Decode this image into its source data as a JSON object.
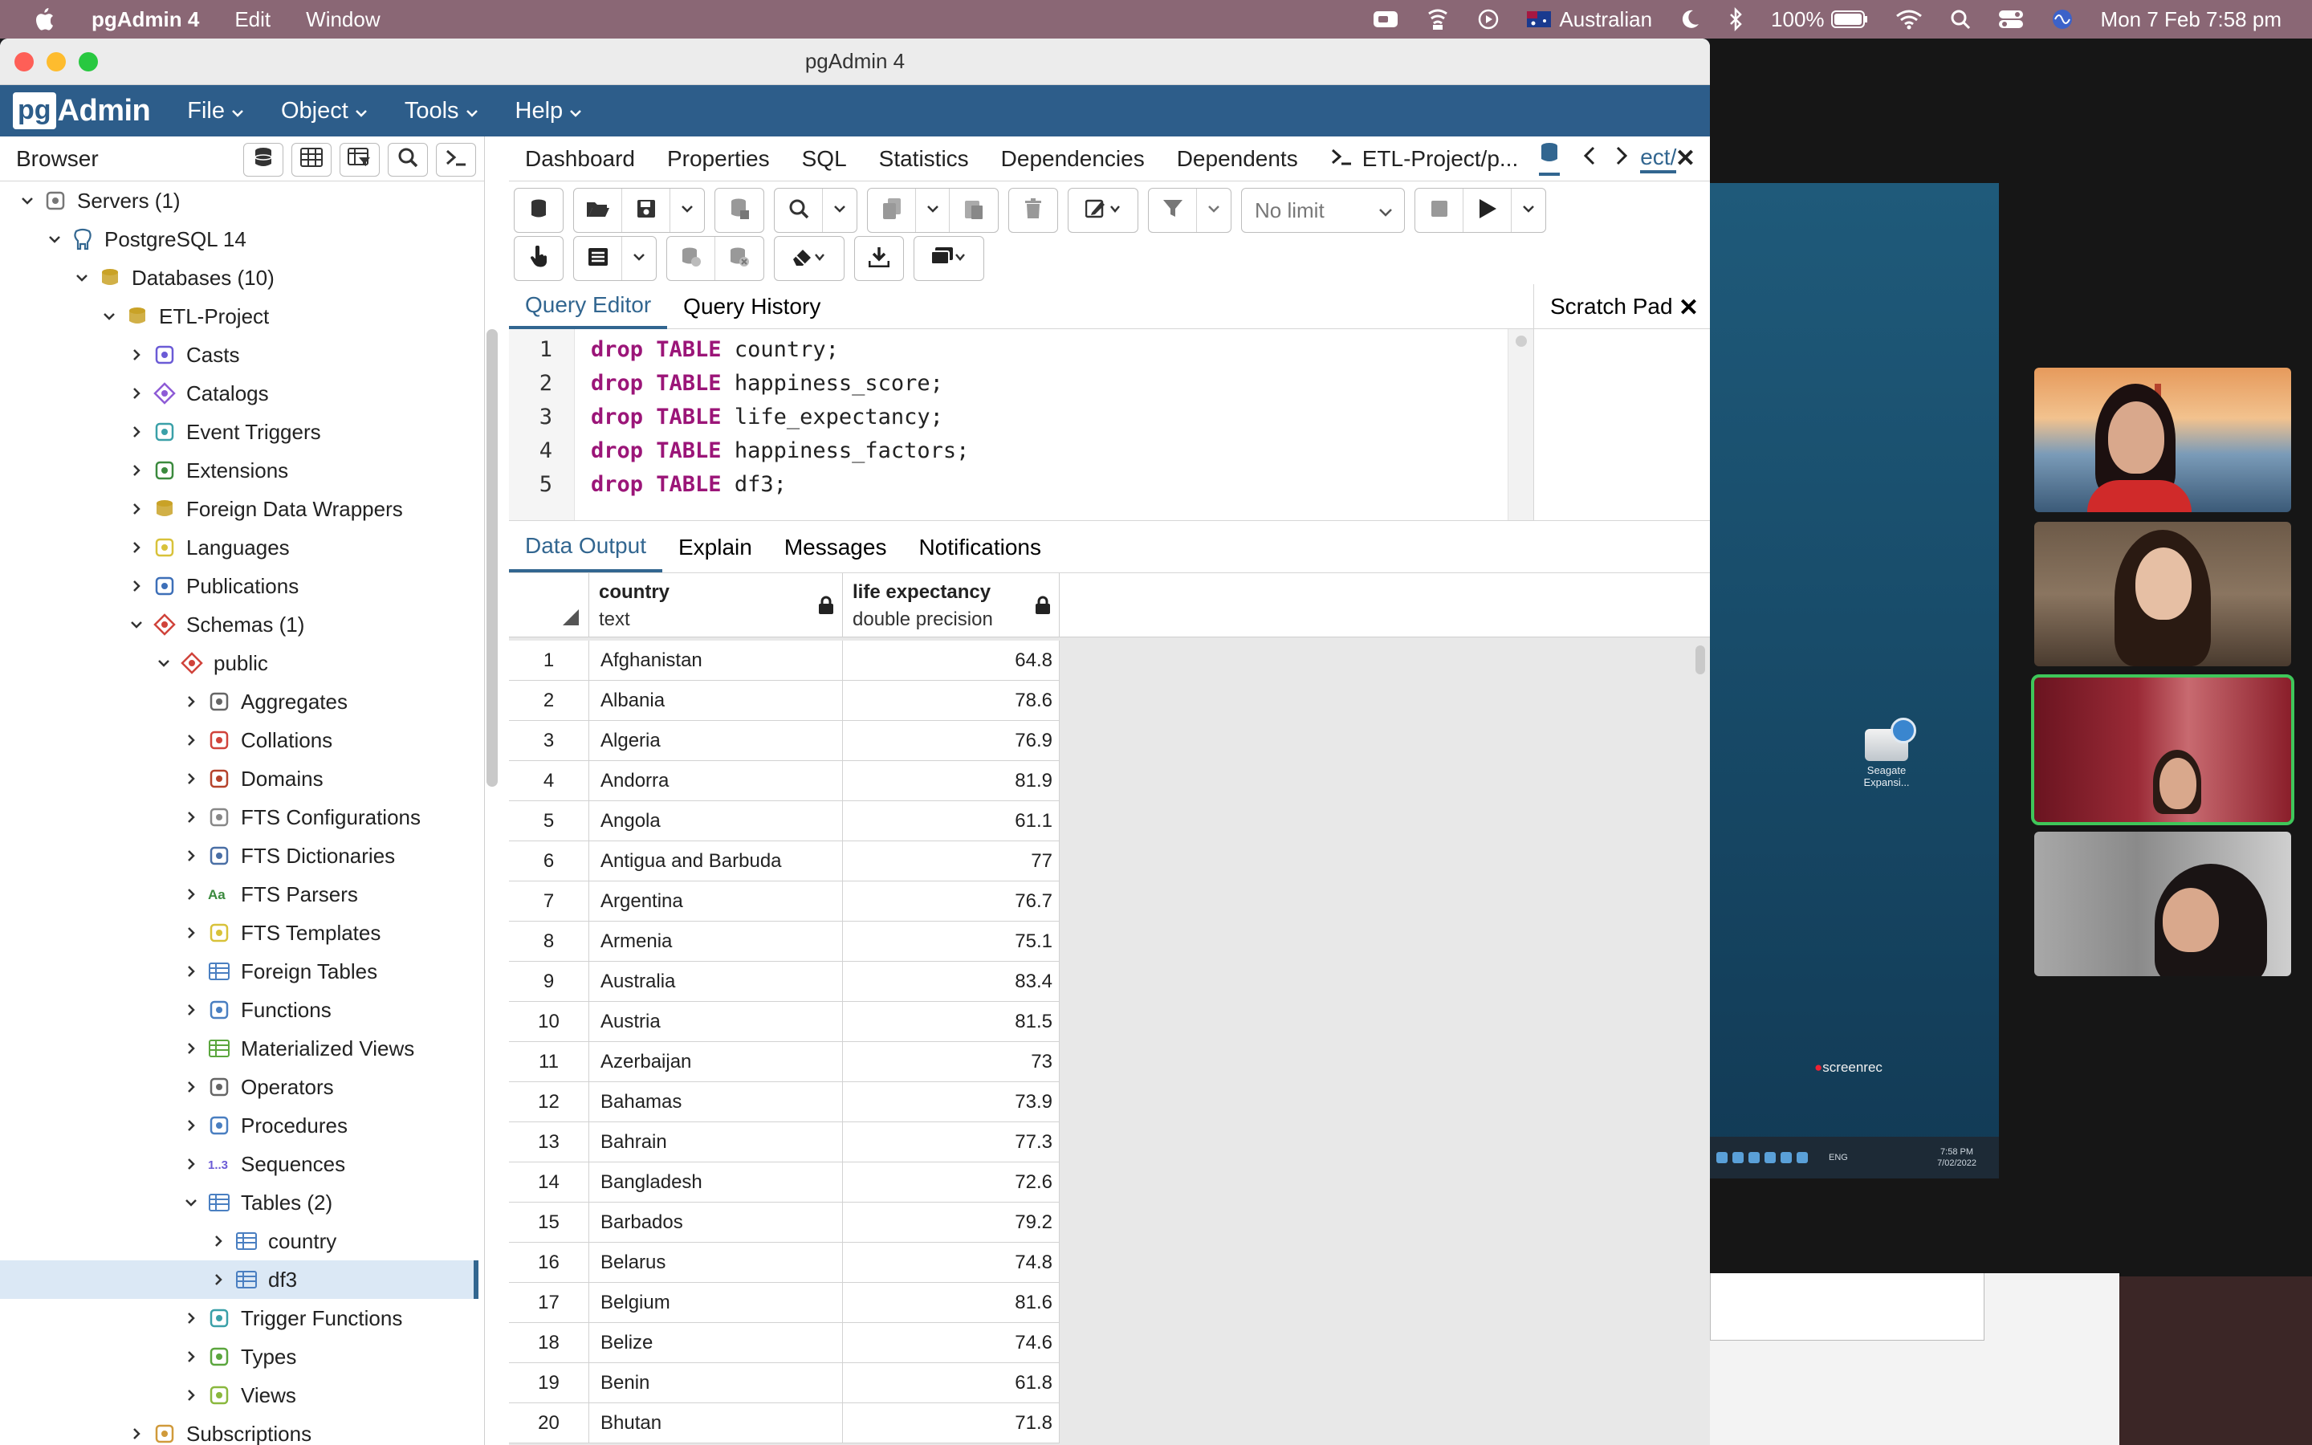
{
  "menubar": {
    "app_name": "pgAdmin 4",
    "items": [
      "Edit",
      "Window"
    ],
    "input_source": "Australian",
    "battery": "100%",
    "datetime": "Mon 7 Feb  7:58 pm"
  },
  "window": {
    "title": "pgAdmin 4"
  },
  "app_menu": {
    "logo_pg": "pg",
    "logo_admin": "Admin",
    "items": [
      "File",
      "Object",
      "Tools",
      "Help"
    ]
  },
  "browser": {
    "title": "Browser",
    "tree": [
      {
        "label": "Servers (1)",
        "depth": 0,
        "expanded": true,
        "icon": "servers-icon"
      },
      {
        "label": "PostgreSQL 14",
        "depth": 1,
        "expanded": true,
        "icon": "postgres-elephant-icon"
      },
      {
        "label": "Databases (10)",
        "depth": 2,
        "expanded": true,
        "icon": "databases-icon"
      },
      {
        "label": "ETL-Project",
        "depth": 3,
        "expanded": true,
        "icon": "database-icon"
      },
      {
        "label": "Casts",
        "depth": 4,
        "expanded": false,
        "icon": "casts-icon"
      },
      {
        "label": "Catalogs",
        "depth": 4,
        "expanded": false,
        "icon": "catalogs-icon"
      },
      {
        "label": "Event Triggers",
        "depth": 4,
        "expanded": false,
        "icon": "event-triggers-icon"
      },
      {
        "label": "Extensions",
        "depth": 4,
        "expanded": false,
        "icon": "extensions-icon"
      },
      {
        "label": "Foreign Data Wrappers",
        "depth": 4,
        "expanded": false,
        "icon": "foreign-data-wrappers-icon"
      },
      {
        "label": "Languages",
        "depth": 4,
        "expanded": false,
        "icon": "languages-icon"
      },
      {
        "label": "Publications",
        "depth": 4,
        "expanded": false,
        "icon": "publications-icon"
      },
      {
        "label": "Schemas (1)",
        "depth": 4,
        "expanded": true,
        "icon": "schemas-icon"
      },
      {
        "label": "public",
        "depth": 5,
        "expanded": true,
        "icon": "schema-icon"
      },
      {
        "label": "Aggregates",
        "depth": 6,
        "expanded": false,
        "icon": "aggregates-icon"
      },
      {
        "label": "Collations",
        "depth": 6,
        "expanded": false,
        "icon": "collations-icon"
      },
      {
        "label": "Domains",
        "depth": 6,
        "expanded": false,
        "icon": "domains-icon"
      },
      {
        "label": "FTS Configurations",
        "depth": 6,
        "expanded": false,
        "icon": "fts-configurations-icon"
      },
      {
        "label": "FTS Dictionaries",
        "depth": 6,
        "expanded": false,
        "icon": "fts-dictionaries-icon"
      },
      {
        "label": "FTS Parsers",
        "depth": 6,
        "expanded": false,
        "icon": "fts-parsers-icon"
      },
      {
        "label": "FTS Templates",
        "depth": 6,
        "expanded": false,
        "icon": "fts-templates-icon"
      },
      {
        "label": "Foreign Tables",
        "depth": 6,
        "expanded": false,
        "icon": "foreign-tables-icon"
      },
      {
        "label": "Functions",
        "depth": 6,
        "expanded": false,
        "icon": "functions-icon"
      },
      {
        "label": "Materialized Views",
        "depth": 6,
        "expanded": false,
        "icon": "materialized-views-icon"
      },
      {
        "label": "Operators",
        "depth": 6,
        "expanded": false,
        "icon": "operators-icon"
      },
      {
        "label": "Procedures",
        "depth": 6,
        "expanded": false,
        "icon": "procedures-icon"
      },
      {
        "label": "Sequences",
        "depth": 6,
        "expanded": false,
        "icon": "sequences-icon"
      },
      {
        "label": "Tables (2)",
        "depth": 6,
        "expanded": true,
        "icon": "tables-icon"
      },
      {
        "label": "country",
        "depth": 7,
        "expanded": false,
        "icon": "table-icon"
      },
      {
        "label": "df3",
        "depth": 7,
        "expanded": false,
        "icon": "table-icon",
        "selected": true
      },
      {
        "label": "Trigger Functions",
        "depth": 6,
        "expanded": false,
        "icon": "trigger-functions-icon"
      },
      {
        "label": "Types",
        "depth": 6,
        "expanded": false,
        "icon": "types-icon"
      },
      {
        "label": "Views",
        "depth": 6,
        "expanded": false,
        "icon": "views-icon"
      },
      {
        "label": "Subscriptions",
        "depth": 4,
        "expanded": false,
        "icon": "subscriptions-icon"
      }
    ]
  },
  "main_tabs": [
    "Dashboard",
    "Properties",
    "SQL",
    "Statistics",
    "Dependencies",
    "Dependents",
    "ETL-Project/p..."
  ],
  "main_tab_extra": "ect/",
  "toolbar": {
    "limit_select": "No limit"
  },
  "editor": {
    "tabs": [
      "Query Editor",
      "Query History"
    ],
    "scratch_pad": "Scratch Pad",
    "lines": [
      {
        "n": "1",
        "kw": "drop TABLE",
        "rest": " country;"
      },
      {
        "n": "2",
        "kw": "drop TABLE",
        "rest": " happiness_score;"
      },
      {
        "n": "3",
        "kw": "drop TABLE",
        "rest": " life_expectancy;"
      },
      {
        "n": "4",
        "kw": "drop TABLE",
        "rest": " happiness_factors;"
      },
      {
        "n": "5",
        "kw": "drop TABLE",
        "rest": " df3;"
      }
    ]
  },
  "output": {
    "tabs": [
      "Data Output",
      "Explain",
      "Messages",
      "Notifications"
    ],
    "columns": [
      {
        "name": "country",
        "type": "text"
      },
      {
        "name": "life expectancy",
        "type": "double precision"
      }
    ],
    "rows": [
      [
        "1",
        "Afghanistan",
        "64.8"
      ],
      [
        "2",
        "Albania",
        "78.6"
      ],
      [
        "3",
        "Algeria",
        "76.9"
      ],
      [
        "4",
        "Andorra",
        "81.9"
      ],
      [
        "5",
        "Angola",
        "61.1"
      ],
      [
        "6",
        "Antigua and Barbuda",
        "77"
      ],
      [
        "7",
        "Argentina",
        "76.7"
      ],
      [
        "8",
        "Armenia",
        "75.1"
      ],
      [
        "9",
        "Australia",
        "83.4"
      ],
      [
        "10",
        "Austria",
        "81.5"
      ],
      [
        "11",
        "Azerbaijan",
        "73"
      ],
      [
        "12",
        "Bahamas",
        "73.9"
      ],
      [
        "13",
        "Bahrain",
        "77.3"
      ],
      [
        "14",
        "Bangladesh",
        "72.6"
      ],
      [
        "15",
        "Barbados",
        "79.2"
      ],
      [
        "16",
        "Belarus",
        "74.8"
      ],
      [
        "17",
        "Belgium",
        "81.6"
      ],
      [
        "18",
        "Belize",
        "74.6"
      ],
      [
        "19",
        "Benin",
        "61.8"
      ],
      [
        "20",
        "Bhutan",
        "71.8"
      ]
    ]
  },
  "shared_screen": {
    "drive_label": "Seagate Expansi...",
    "recorder": "screenrec",
    "clock_time": "7:58 PM",
    "clock_date": "7/02/2022",
    "lang": "ENG"
  },
  "colors": {
    "pg_blue": "#2d5d8a",
    "accent": "#326690",
    "keyword": "#9b1578",
    "menubar": "#8a6775"
  }
}
